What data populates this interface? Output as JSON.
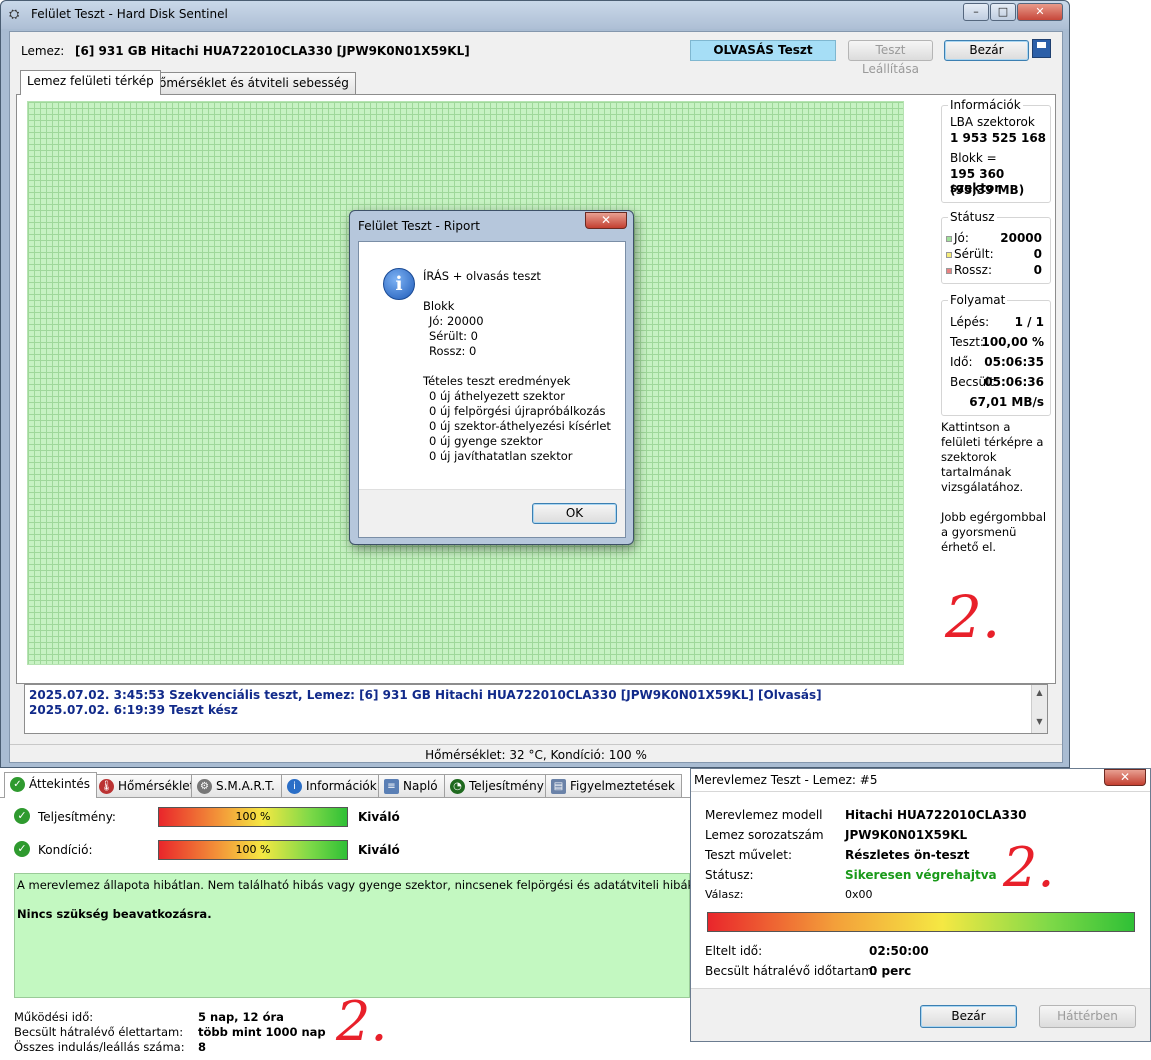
{
  "main_window": {
    "title": "Felület Teszt - Hard Disk Sentinel",
    "controls": {
      "minimize": "–",
      "maximize": "□",
      "close": "✕"
    },
    "disk_label": "Lemez:",
    "disk_value": "[6] 931 GB  Hitachi HUA722010CLA330 [JPW9K0N01X59KL]",
    "mode_badge": "OLVASÁS Teszt",
    "stop_button": "Teszt Leállítása",
    "close_button": "Bezár",
    "tabs": [
      {
        "label": "Lemez felületi térkép"
      },
      {
        "label": "Hőmérséklet és átviteli sebesség"
      }
    ],
    "info": {
      "title": "Információk",
      "lba_label": "LBA szektorok",
      "lba_value": "1 953 525 168",
      "block_label": "Blokk =",
      "block_value": "195 360 szektor",
      "block_size": "(95,39 MB)"
    },
    "status": {
      "title": "Státusz",
      "good_label": "Jó:",
      "good_value": "20000",
      "damaged_label": "Sérült:",
      "damaged_value": "0",
      "bad_label": "Rossz:",
      "bad_value": "0",
      "colors": {
        "good": "#9fe09a",
        "damaged": "#f5ec7a",
        "bad": "#e88282"
      }
    },
    "progress": {
      "title": "Folyamat",
      "step_label": "Lépés:",
      "step_value": "1 / 1",
      "test_label": "Teszt:",
      "test_value": "100,00 %",
      "time_label": "Idő:",
      "time_value": "05:06:35",
      "est_label": "Becsült:",
      "est_value": "05:06:36",
      "speed": "67,01 MB/s"
    },
    "help_text_1": "Kattintson a felületi térképre a szektorok tartalmának vizsgálatához.",
    "help_text_2": "Jobb egérgombbal a gyorsmenü érhető el.",
    "log": [
      "2025.07.02.  3:45:53   Szekvenciális teszt, Lemez: [6] 931 GB  Hitachi HUA722010CLA330 [JPW9K0N01X59KL] [Olvasás]",
      "2025.07.02.  6:19:39   Teszt kész"
    ],
    "status_bar": "Hőmérséklet: 32  °C,  Kondíció: 100 %"
  },
  "report_dialog": {
    "title": "Felület Teszt - Riport",
    "close": "✕",
    "lines": [
      "ÍRÁS + olvasás teszt",
      "Blokk",
      "  Jó: 20000",
      "  Sérült: 0",
      "  Rossz: 0",
      "Tételes teszt eredmények",
      "  0 új áthelyezett szektor",
      "  0 új felpörgési újrapróbálkozás",
      "  0 új szektor-áthelyezési kísérlet",
      "  0 új gyenge szektor",
      "  0 új javíthatatlan szektor"
    ],
    "ok_button": "OK"
  },
  "overview": {
    "tabs": [
      {
        "label": "Áttekintés",
        "icon": "check-icon"
      },
      {
        "label": "Hőmérséklet",
        "icon": "thermometer-icon"
      },
      {
        "label": "S.M.A.R.T.",
        "icon": "smart-icon"
      },
      {
        "label": "Információk",
        "icon": "info-icon"
      },
      {
        "label": "Napló",
        "icon": "log-icon"
      },
      {
        "label": "Teljesítmény",
        "icon": "performance-icon"
      },
      {
        "label": "Figyelmeztetések",
        "icon": "alerts-icon"
      }
    ],
    "performance_label": "Teljesítmény:",
    "performance_value": "100 %",
    "performance_fraction": 1.0,
    "performance_rating": "Kiváló",
    "condition_label": "Kondíció:",
    "condition_value": "100 %",
    "condition_fraction": 1.0,
    "condition_rating": "Kiváló",
    "status_text": "A merevlemez állapota hibátlan. Nem található hibás vagy gyenge szektor, nincsenek felpörgési és adatátviteli hibák sem.",
    "status_action": "Nincs szükség beavatkozásra.",
    "uptime_label": "Működési idő:",
    "uptime_value": "5 nap, 12 óra",
    "remaining_label": "Becsült hátralévő élettartam:",
    "remaining_value": "több mint 1000 nap",
    "starts_label": "Összes indulás/leállás száma:",
    "starts_value": "8"
  },
  "selftest_dialog": {
    "title": "Merevlemez Teszt - Lemez: #5",
    "close": "✕",
    "model_label": "Merevlemez modell",
    "model_value": "Hitachi HUA722010CLA330",
    "serial_label": "Lemez sorozatszám",
    "serial_value": "JPW9K0N01X59KL",
    "op_label": "Teszt művelet:",
    "op_value": "Részletes ön-teszt",
    "status_label": "Státusz:",
    "status_value": "Sikeresen végrehajtva",
    "status_color": "#1a9a1a",
    "response_label": "Válasz:",
    "response_value": "0x00",
    "progress_fraction": 1.0,
    "elapsed_label": "Eltelt idő:",
    "elapsed_value": "02:50:00",
    "remaining_label": "Becsült hátralévő időtartam:",
    "remaining_value": "0 perc",
    "close_button": "Bezár",
    "background_button": "Háttérben"
  },
  "handwritten": {
    "mark": "2."
  }
}
